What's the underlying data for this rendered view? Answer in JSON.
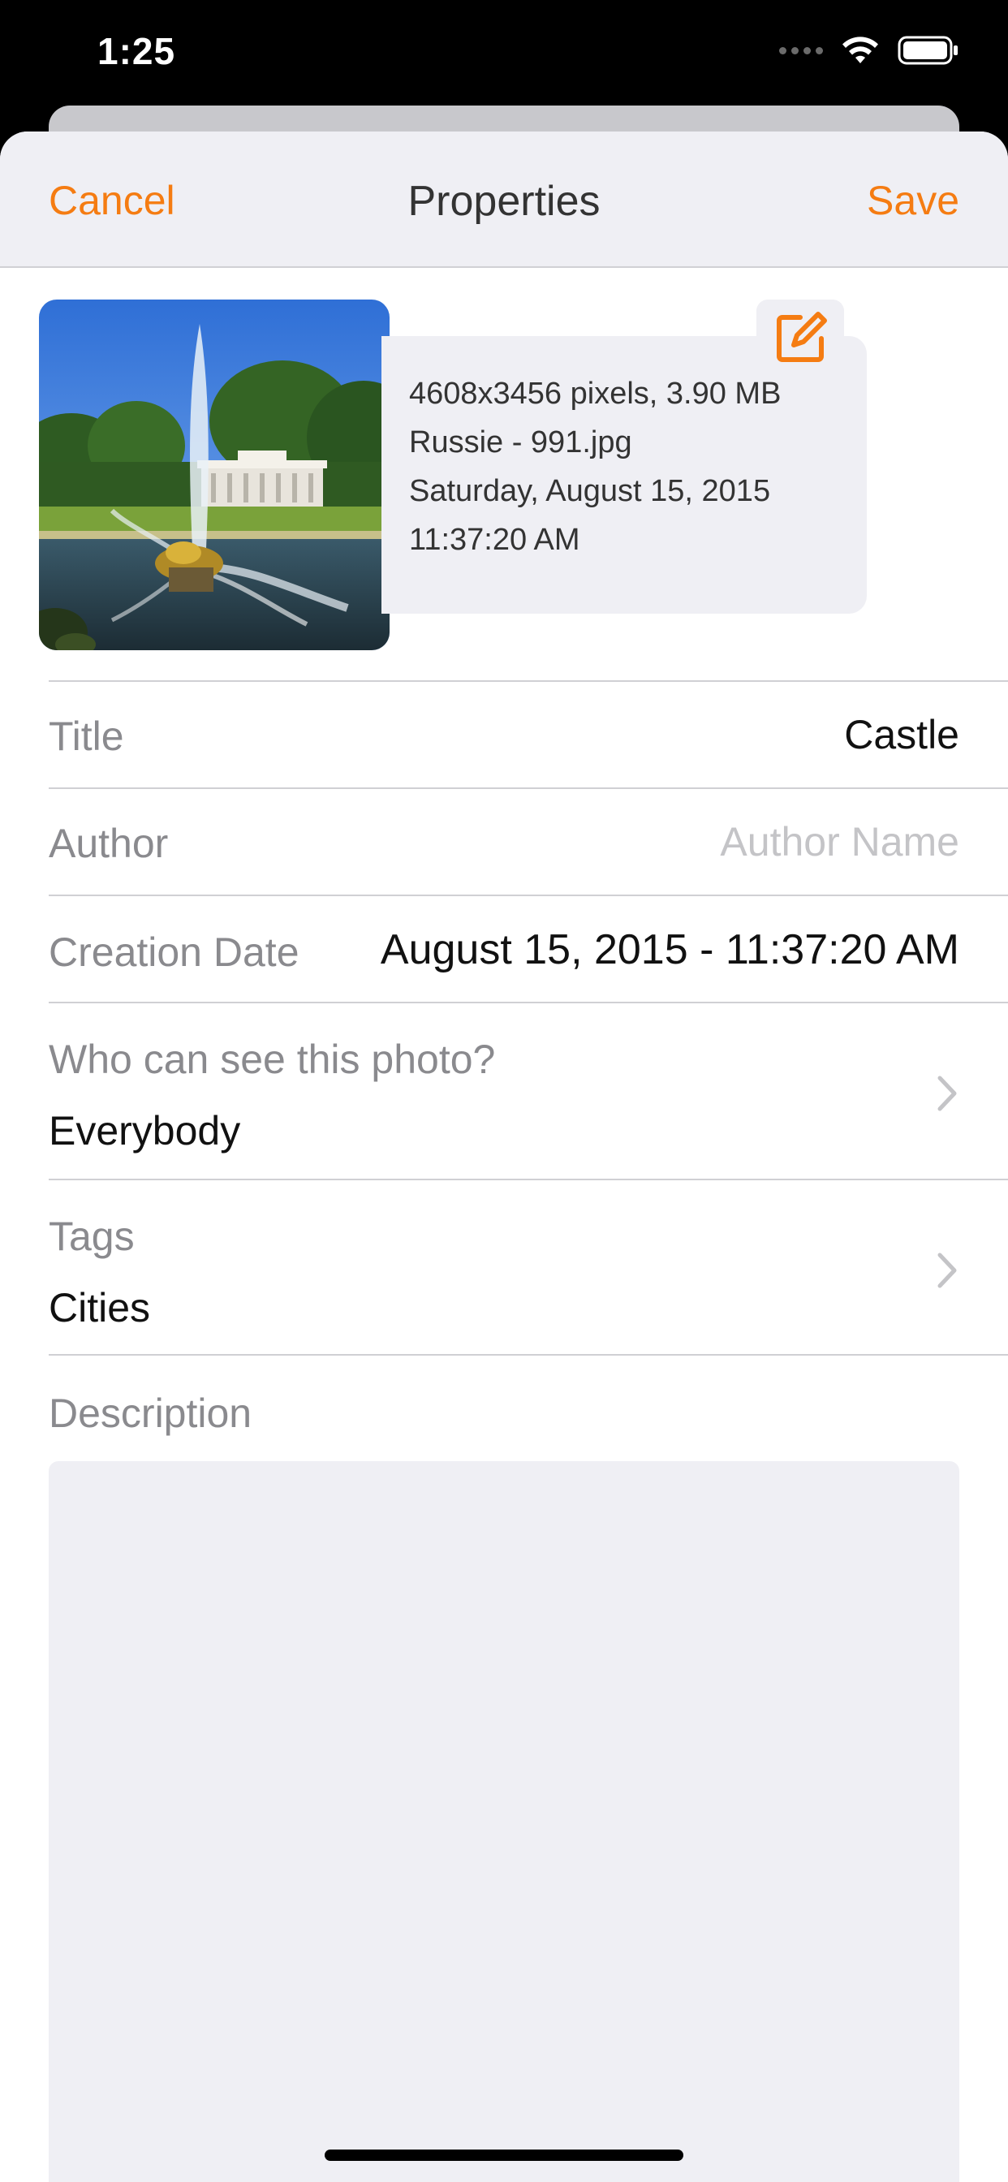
{
  "status_bar": {
    "time": "1:25"
  },
  "nav": {
    "cancel_label": "Cancel",
    "title": "Properties",
    "save_label": "Save"
  },
  "photo": {
    "dimensions_size": "4608x3456 pixels, 3.90 MB",
    "filename": "Russie - 991.jpg",
    "date_line": "Saturday, August 15, 2015",
    "time_line": "11:37:20 AM"
  },
  "fields": {
    "title": {
      "label": "Title",
      "value": "Castle"
    },
    "author": {
      "label": "Author",
      "placeholder": "Author Name"
    },
    "creation_date": {
      "label": "Creation Date",
      "value": "August 15, 2015 - 11:37:20 AM"
    },
    "visibility": {
      "label": "Who can see this photo?",
      "value": "Everybody"
    },
    "tags": {
      "label": "Tags",
      "value": "Cities"
    },
    "description": {
      "label": "Description"
    }
  },
  "colors": {
    "accent": "#f57c12",
    "card_bg": "#efeff4",
    "label_gray": "#8a8a8e"
  },
  "icons": {
    "edit": "square-pencil-icon",
    "disclosure": "chevron-right-icon"
  }
}
